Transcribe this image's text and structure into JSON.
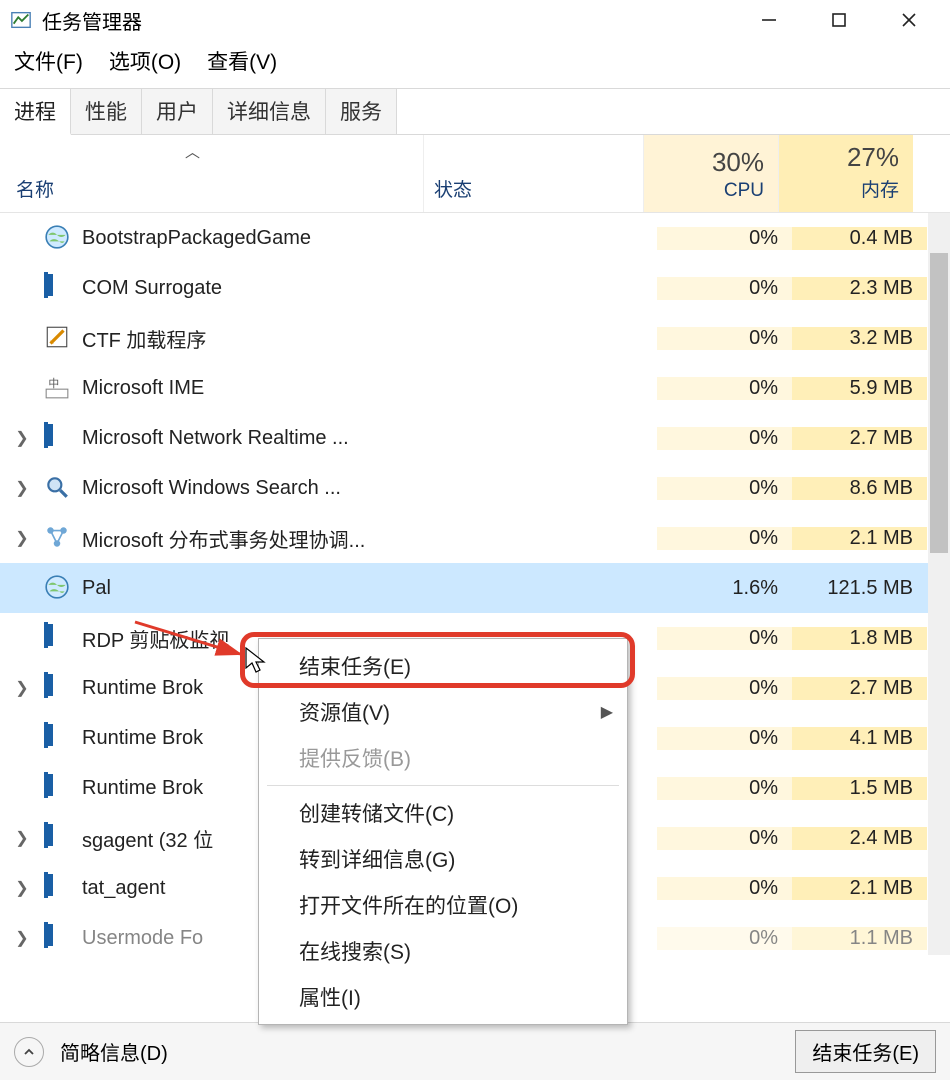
{
  "window": {
    "title": "任务管理器",
    "menu": {
      "file": "文件(F)",
      "options": "选项(O)",
      "view": "查看(V)"
    }
  },
  "tabs": {
    "processes": "进程",
    "performance": "性能",
    "users": "用户",
    "details": "详细信息",
    "services": "服务"
  },
  "columns": {
    "name": "名称",
    "status": "状态",
    "cpu_pct": "30%",
    "cpu_label": "CPU",
    "mem_pct": "27%",
    "mem_label": "内存"
  },
  "rows": [
    {
      "expand": "",
      "icon": "globe",
      "name": "BootstrapPackagedGame",
      "cpu": "0%",
      "mem": "0.4 MB"
    },
    {
      "expand": "",
      "icon": "box",
      "name": "COM Surrogate",
      "cpu": "0%",
      "mem": "2.3 MB"
    },
    {
      "expand": "",
      "icon": "pencil",
      "name": "CTF 加载程序",
      "cpu": "0%",
      "mem": "3.2 MB"
    },
    {
      "expand": "",
      "icon": "ime",
      "name": "Microsoft IME",
      "cpu": "0%",
      "mem": "5.9 MB"
    },
    {
      "expand": ">",
      "icon": "box",
      "name": "Microsoft Network Realtime ...",
      "cpu": "0%",
      "mem": "2.7 MB"
    },
    {
      "expand": ">",
      "icon": "search",
      "name": "Microsoft Windows Search ...",
      "cpu": "0%",
      "mem": "8.6 MB"
    },
    {
      "expand": ">",
      "icon": "dtc",
      "name": "Microsoft 分布式事务处理协调...",
      "cpu": "0%",
      "mem": "2.1 MB"
    },
    {
      "expand": "",
      "icon": "globe",
      "name": "Pal",
      "cpu": "1.6%",
      "mem": "121.5 MB",
      "selected": true
    },
    {
      "expand": "",
      "icon": "box",
      "name": "RDP 剪贴板监视",
      "cpu": "0%",
      "mem": "1.8 MB"
    },
    {
      "expand": ">",
      "icon": "box",
      "name": "Runtime Brok",
      "cpu": "0%",
      "mem": "2.7 MB"
    },
    {
      "expand": "",
      "icon": "box",
      "name": "Runtime Brok",
      "cpu": "0%",
      "mem": "4.1 MB"
    },
    {
      "expand": "",
      "icon": "box",
      "name": "Runtime Brok",
      "cpu": "0%",
      "mem": "1.5 MB"
    },
    {
      "expand": ">",
      "icon": "box",
      "name": "sgagent (32 位",
      "cpu": "0%",
      "mem": "2.4 MB"
    },
    {
      "expand": ">",
      "icon": "box",
      "name": "tat_agent",
      "cpu": "0%",
      "mem": "2.1 MB"
    },
    {
      "expand": ">",
      "icon": "box",
      "name": "Usermode Fo",
      "cpu": "0%",
      "mem": "1.1 MB",
      "faded": true
    }
  ],
  "context_menu": {
    "end_task": "结束任务(E)",
    "resource_values": "资源值(V)",
    "feedback": "提供反馈(B)",
    "create_dump": "创建转储文件(C)",
    "go_to_details": "转到详细信息(G)",
    "open_location": "打开文件所在的位置(O)",
    "search_online": "在线搜索(S)",
    "properties": "属性(I)"
  },
  "footer": {
    "brief_info": "简略信息(D)",
    "end_task_btn": "结束任务(E)"
  }
}
